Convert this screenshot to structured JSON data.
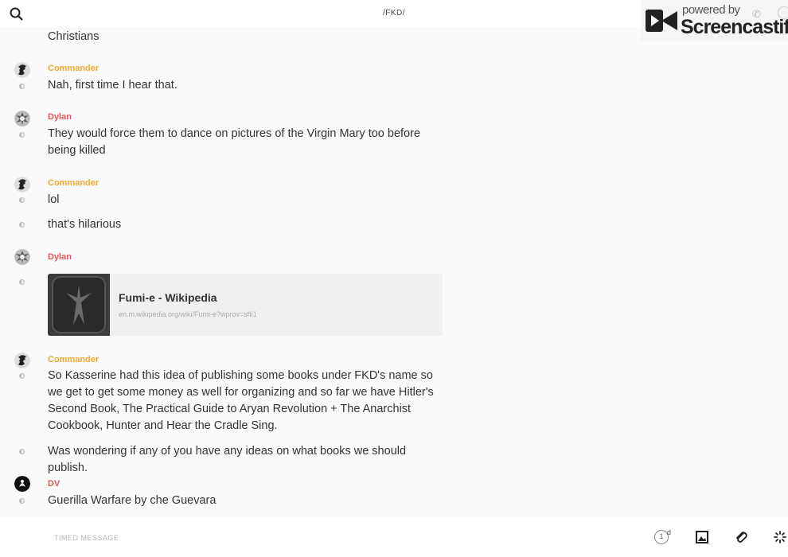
{
  "header": {
    "channel_title": "/FKD/"
  },
  "watermark": {
    "powered_by": "powered by",
    "brand": "Screencastify"
  },
  "messages": [
    {
      "author": "",
      "author_color": "#f0a830",
      "text": "Christians"
    },
    {
      "author": "Commander",
      "author_color": "#f0a830",
      "text": "Nah, first time I hear that."
    },
    {
      "author": "Dylan",
      "author_color": "#e0565b",
      "text": "They would force them to dance on pictures of the Virgin Mary too before being killed"
    },
    {
      "author": "Commander",
      "author_color": "#f0a830",
      "text": "lol"
    },
    {
      "author": "",
      "author_color": "#f0a830",
      "text": "that's hilarious"
    },
    {
      "author": "Dylan",
      "author_color": "#e0565b",
      "link": {
        "title": "Fumi-e - Wikipedia",
        "url": "en.m.wikipedia.org/wiki/Fumi-e?wprov=sfti1"
      }
    },
    {
      "author": "Commander",
      "author_color": "#f0a830",
      "text": "So Kasserine had this idea of publishing some books under FKD's name so we get to get some money as well for organizing and so far we have Hitler's Second Book, The Practical Guide to Aryan Revolution + The Anarchist Cookbook, Hunter and Hear the Cradle Sing."
    },
    {
      "author": "",
      "author_color": "#f0a830",
      "text": "Was wondering if any of you have any ideas on what books we should publish."
    },
    {
      "author": "DV",
      "author_color": "#e0565b",
      "text": "Guerilla Warfare by che Guevara"
    }
  ],
  "composer": {
    "placeholder": "TIMED MESSAGE",
    "timer_value": "1",
    "timer_unit": "d"
  },
  "icons": [
    "search-icon",
    "image-icon",
    "paperclip-icon",
    "spinner-icon",
    "phone-icon",
    "info-icon"
  ]
}
